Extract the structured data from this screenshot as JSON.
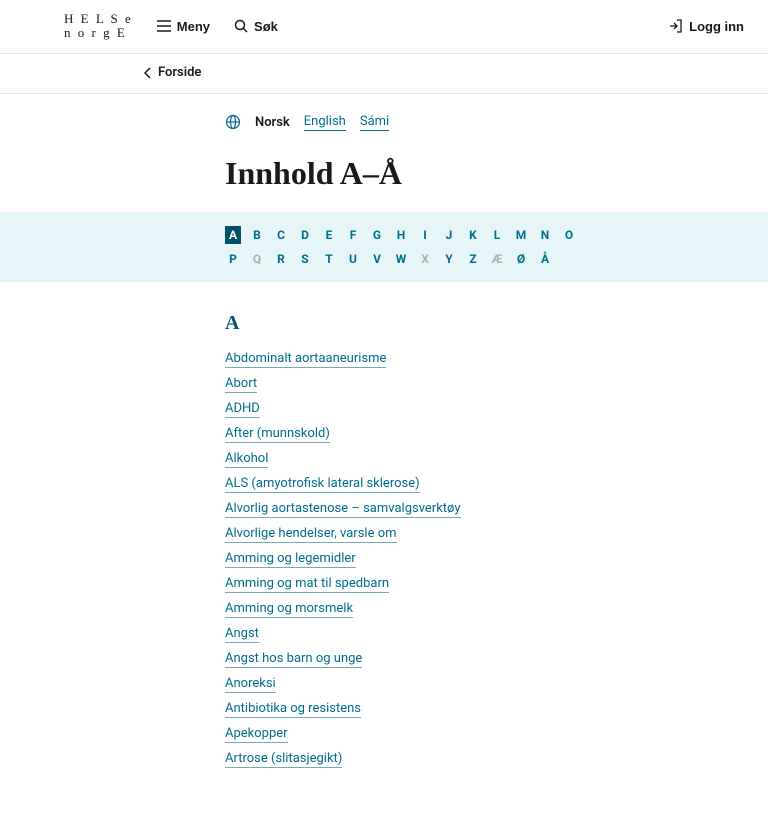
{
  "header": {
    "logo_line1": "H E L S e",
    "logo_line2": "n o r g E",
    "menu_label": "Meny",
    "search_label": "Søk",
    "login_label": "Logg inn"
  },
  "breadcrumb": {
    "back_label": "Forside"
  },
  "languages": {
    "current": "Norsk",
    "others": [
      "English",
      "Sámi"
    ]
  },
  "title": "Innhold A–Å",
  "alphabet": {
    "row1": [
      {
        "l": "A",
        "state": "selected"
      },
      {
        "l": "B",
        "state": "link"
      },
      {
        "l": "C",
        "state": "link"
      },
      {
        "l": "D",
        "state": "link"
      },
      {
        "l": "E",
        "state": "link"
      },
      {
        "l": "F",
        "state": "link"
      },
      {
        "l": "G",
        "state": "link"
      },
      {
        "l": "H",
        "state": "link"
      },
      {
        "l": "I",
        "state": "link"
      },
      {
        "l": "J",
        "state": "link"
      },
      {
        "l": "K",
        "state": "link"
      },
      {
        "l": "L",
        "state": "link"
      },
      {
        "l": "M",
        "state": "link"
      },
      {
        "l": "N",
        "state": "link"
      },
      {
        "l": "O",
        "state": "link"
      }
    ],
    "row2": [
      {
        "l": "P",
        "state": "link"
      },
      {
        "l": "Q",
        "state": "disabled"
      },
      {
        "l": "R",
        "state": "link"
      },
      {
        "l": "S",
        "state": "link"
      },
      {
        "l": "T",
        "state": "link"
      },
      {
        "l": "U",
        "state": "link"
      },
      {
        "l": "V",
        "state": "link"
      },
      {
        "l": "W",
        "state": "link"
      },
      {
        "l": "X",
        "state": "disabled"
      },
      {
        "l": "Y",
        "state": "link"
      },
      {
        "l": "Z",
        "state": "link"
      },
      {
        "l": "Æ",
        "state": "disabled"
      },
      {
        "l": "Ø",
        "state": "link"
      },
      {
        "l": "Å",
        "state": "link"
      }
    ]
  },
  "section": {
    "letter": "A",
    "entries": [
      "Abdominalt aortaaneurisme",
      "Abort",
      "ADHD",
      "After (munnskold)",
      "Alkohol",
      "ALS (amyotrofisk lateral sklerose)",
      "Alvorlig aortastenose – samvalgsverktøy",
      "Alvorlige hendelser, varsle om",
      "Amming og legemidler",
      "Amming og mat til spedbarn",
      "Amming og morsmelk",
      "Angst",
      "Angst hos barn og unge",
      "Anoreksi",
      "Antibiotika og resistens",
      "Apekopper",
      "Artrose (slitasjegikt)"
    ]
  }
}
